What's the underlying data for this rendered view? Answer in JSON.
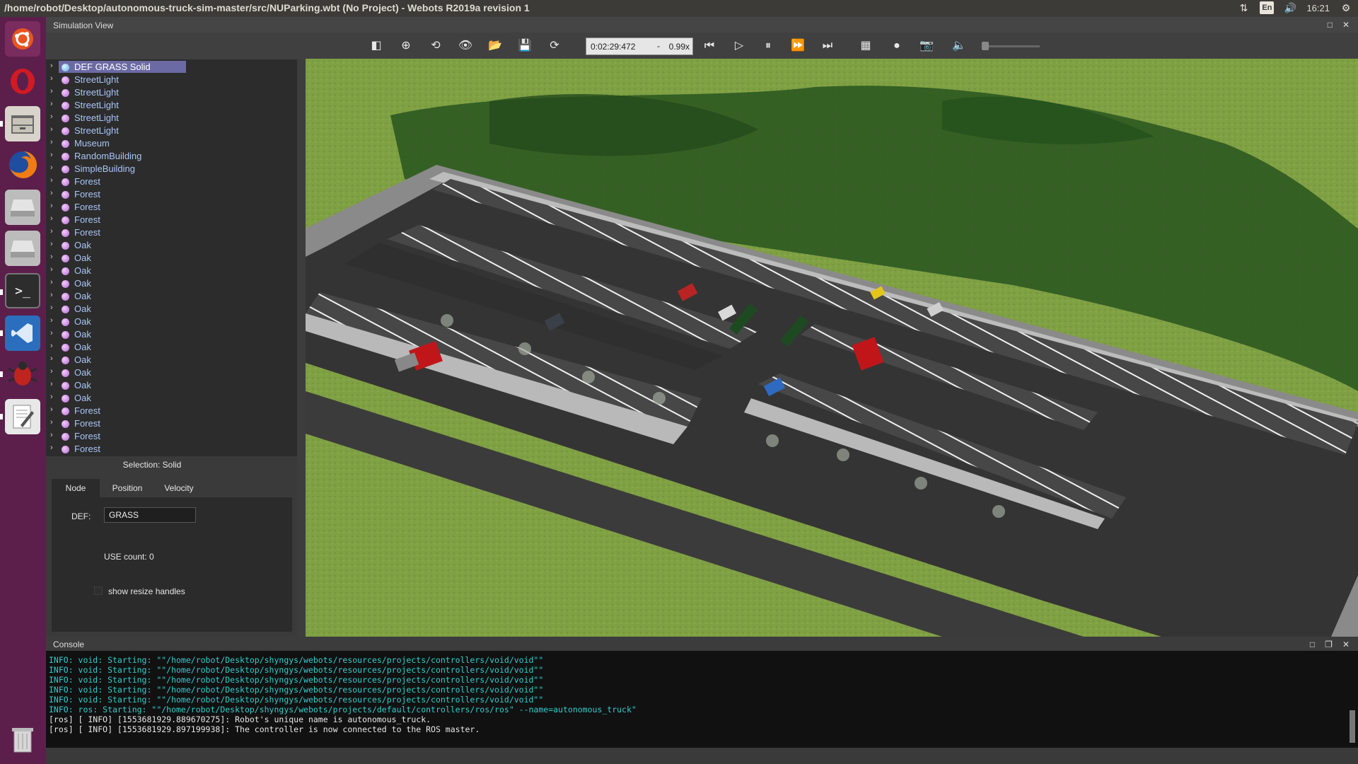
{
  "window": {
    "title": "/home/robot/Desktop/autonomous-truck-sim-master/src/NUParking.wbt (No Project) - Webots R2019a revision 1",
    "lang": "En",
    "clock": "16:21"
  },
  "simview": {
    "title": "Simulation View",
    "time": "0:02:29:472",
    "dash": "-",
    "speed": "0.99x"
  },
  "scene_tree": {
    "items": [
      {
        "label": "DEF GRASS Solid",
        "selected": true
      },
      {
        "label": "StreetLight"
      },
      {
        "label": "StreetLight"
      },
      {
        "label": "StreetLight"
      },
      {
        "label": "StreetLight"
      },
      {
        "label": "StreetLight"
      },
      {
        "label": "Museum"
      },
      {
        "label": "RandomBuilding"
      },
      {
        "label": "SimpleBuilding"
      },
      {
        "label": "Forest"
      },
      {
        "label": "Forest"
      },
      {
        "label": "Forest"
      },
      {
        "label": "Forest"
      },
      {
        "label": "Forest"
      },
      {
        "label": "Oak"
      },
      {
        "label": "Oak"
      },
      {
        "label": "Oak"
      },
      {
        "label": "Oak"
      },
      {
        "label": "Oak"
      },
      {
        "label": "Oak"
      },
      {
        "label": "Oak"
      },
      {
        "label": "Oak"
      },
      {
        "label": "Oak"
      },
      {
        "label": "Oak"
      },
      {
        "label": "Oak"
      },
      {
        "label": "Oak"
      },
      {
        "label": "Oak"
      },
      {
        "label": "Forest"
      },
      {
        "label": "Forest"
      },
      {
        "label": "Forest"
      },
      {
        "label": "Forest"
      }
    ]
  },
  "selection": {
    "title": "Selection: Solid",
    "tabs": [
      "Node",
      "Position",
      "Velocity"
    ],
    "def_label": "DEF:",
    "def_value": "GRASS",
    "use_count": "USE count: 0",
    "show_resize": "show resize handles"
  },
  "console": {
    "title": "Console",
    "lines": [
      {
        "kind": "info",
        "text": "INFO: void: Starting: \"\"/home/robot/Desktop/shyngys/webots/resources/projects/controllers/void/void\"\""
      },
      {
        "kind": "info",
        "text": "INFO: void: Starting: \"\"/home/robot/Desktop/shyngys/webots/resources/projects/controllers/void/void\"\""
      },
      {
        "kind": "info",
        "text": "INFO: void: Starting: \"\"/home/robot/Desktop/shyngys/webots/resources/projects/controllers/void/void\"\""
      },
      {
        "kind": "info",
        "text": "INFO: void: Starting: \"\"/home/robot/Desktop/shyngys/webots/resources/projects/controllers/void/void\"\""
      },
      {
        "kind": "info",
        "text": "INFO: void: Starting: \"\"/home/robot/Desktop/shyngys/webots/resources/projects/controllers/void/void\"\""
      },
      {
        "kind": "info",
        "text": "INFO: ros: Starting: \"\"/home/robot/Desktop/shyngys/webots/projects/default/controllers/ros/ros\" --name=autonomous_truck\""
      },
      {
        "kind": "ros",
        "text": "[ros] [ INFO] [1553681929.889670275]: Robot's unique name is autonomous_truck."
      },
      {
        "kind": "ros",
        "text": "[ros] [ INFO] [1553681929.897199938]: The controller is now connected to the ROS master."
      }
    ]
  }
}
